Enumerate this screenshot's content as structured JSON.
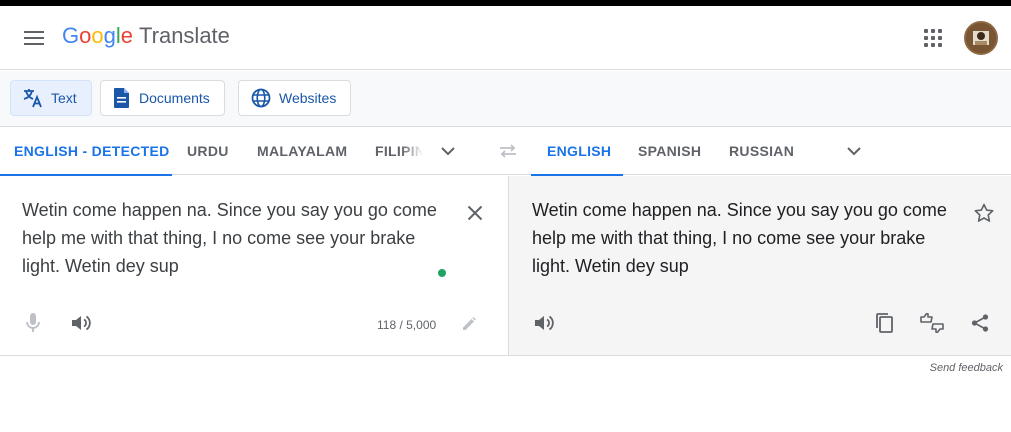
{
  "header": {
    "brand_letters": [
      {
        "ch": "G",
        "color": "#4285f4"
      },
      {
        "ch": "o",
        "color": "#ea4335"
      },
      {
        "ch": "o",
        "color": "#fbbc05"
      },
      {
        "ch": "g",
        "color": "#4285f4"
      },
      {
        "ch": "l",
        "color": "#34a853"
      },
      {
        "ch": "e",
        "color": "#ea4335"
      }
    ],
    "product": "Translate",
    "icons": [
      "menu-icon",
      "apps-grid-icon",
      "avatar"
    ]
  },
  "modes": {
    "text": "Text",
    "documents": "Documents",
    "websites": "Websites"
  },
  "source_langs": {
    "detected": "ENGLISH - DETECTED",
    "urdu": "URDU",
    "malayalam": "MALAYALAM",
    "filipino": "FILIPINO"
  },
  "target_langs": {
    "english": "ENGLISH",
    "spanish": "SPANISH",
    "russian": "RUSSIAN"
  },
  "source": {
    "text": "Wetin come happen na. Since you say you go come help me with that thing, I no come see your brake light. Wetin dey sup",
    "char_count": "118 / 5,000"
  },
  "result": {
    "text": "Wetin come happen na. Since you say you go come help me with that thing, I no come see your brake light. Wetin dey sup"
  },
  "footer": {
    "feedback": "Send feedback"
  },
  "colors": {
    "accent": "#1a73e8",
    "active_mode_bg": "#e8f0fe",
    "result_bg": "#f5f5f5",
    "status_dot": "#1ea362"
  }
}
